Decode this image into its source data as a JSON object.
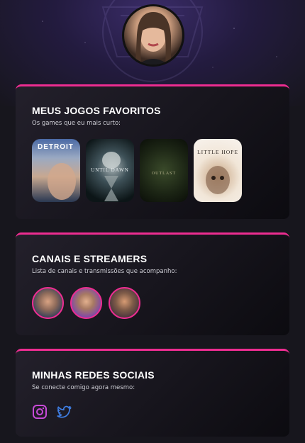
{
  "profile": {
    "avatar": "profile-avatar"
  },
  "sections": {
    "games": {
      "title": "MEUS JOGOS FAVORITOS",
      "subtitle": "Os games que eu mais curto:",
      "items": [
        {
          "name": "DETROIT"
        },
        {
          "name": "UNTIL DAWN"
        },
        {
          "name": "OUTLAST"
        },
        {
          "name": "LITTLE HOPE"
        }
      ]
    },
    "streamers": {
      "title": "CANAIS E STREAMERS",
      "subtitle": "Lista de canais e transmissões que acompanho:",
      "items": [
        {
          "name": "streamer-1"
        },
        {
          "name": "streamer-2"
        },
        {
          "name": "streamer-3"
        }
      ]
    },
    "social": {
      "title": "MINHAS REDES SOCIAIS",
      "subtitle": "Se conecte comigo agora mesmo:",
      "items": [
        {
          "icon": "instagram-icon",
          "color": "#c84ad8"
        },
        {
          "icon": "twitter-icon",
          "color": "#3f7fe6"
        }
      ]
    }
  },
  "colors": {
    "accent": "#ed2d91",
    "background": "#17161d"
  }
}
